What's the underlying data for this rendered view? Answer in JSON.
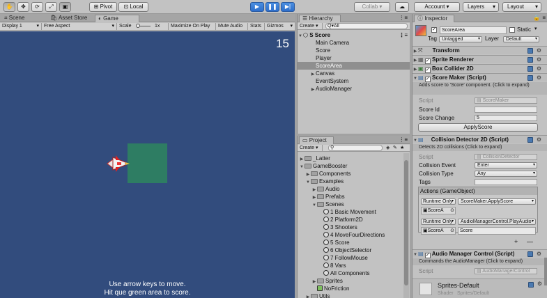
{
  "toolbar": {
    "pivot": "Pivot",
    "local": "Local",
    "play": "▶",
    "pause": "❚❚",
    "step": "▶|",
    "collab": "Collab ▾",
    "cloud": "☁",
    "account": "Account ▾",
    "layers": "Layers",
    "layout": "Layout"
  },
  "left_tabs": [
    "Scene",
    "Asset Store",
    "Game"
  ],
  "game_toolbar": {
    "display": "Display 1",
    "aspect": "Free Aspect",
    "scale_label": "Scale",
    "scale_value": "1x",
    "maximize": "Maximize On Play",
    "mute": "Mute Audio",
    "stats": "Stats",
    "gizmos": "Gizmos"
  },
  "game": {
    "score": "15",
    "instructions_line1": "Use arrow keys to move.",
    "instructions_line2": "Hit que green area to score.",
    "colors": {
      "background": "#324c7d",
      "score_area": "#2e7d63"
    }
  },
  "hierarchy": {
    "tab": "Hierarchy",
    "create": "Create ▾",
    "search_placeholder": "Q▾All",
    "scene_name": "S Score",
    "items": [
      {
        "label": "Main Camera",
        "indent": 1,
        "arrow": "",
        "selected": false
      },
      {
        "label": "Score",
        "indent": 1,
        "arrow": "",
        "selected": false
      },
      {
        "label": "Player",
        "indent": 1,
        "arrow": "",
        "selected": false
      },
      {
        "label": "ScoreArea",
        "indent": 1,
        "arrow": "",
        "selected": true
      },
      {
        "label": "Canvas",
        "indent": 1,
        "arrow": "▶",
        "selected": false
      },
      {
        "label": "EventSystem",
        "indent": 1,
        "arrow": "",
        "selected": false
      },
      {
        "label": "AudioManager",
        "indent": 1,
        "arrow": "▶",
        "selected": false
      }
    ]
  },
  "project": {
    "tab": "Project",
    "create": "Create ▾",
    "items": [
      {
        "label": "_Latter",
        "type": "folder",
        "indent": 0,
        "arrow": "▶"
      },
      {
        "label": "GameBooster",
        "type": "folder",
        "indent": 0,
        "arrow": "▼"
      },
      {
        "label": "Components",
        "type": "folder",
        "indent": 1,
        "arrow": "▶"
      },
      {
        "label": "Examples",
        "type": "folder",
        "indent": 1,
        "arrow": "▼"
      },
      {
        "label": "Audio",
        "type": "folder",
        "indent": 2,
        "arrow": "▶"
      },
      {
        "label": "Prefabs",
        "type": "folder",
        "indent": 2,
        "arrow": "▶"
      },
      {
        "label": "Scenes",
        "type": "folder",
        "indent": 2,
        "arrow": "▼"
      },
      {
        "label": "1 Basic Movement",
        "type": "scene",
        "indent": 3,
        "arrow": ""
      },
      {
        "label": "2 Platform2D",
        "type": "scene",
        "indent": 3,
        "arrow": ""
      },
      {
        "label": "3 Shooters",
        "type": "scene",
        "indent": 3,
        "arrow": ""
      },
      {
        "label": "4 MoveFourDirections",
        "type": "scene",
        "indent": 3,
        "arrow": ""
      },
      {
        "label": "5 Score",
        "type": "scene",
        "indent": 3,
        "arrow": ""
      },
      {
        "label": "6 ObjectSelector",
        "type": "scene",
        "indent": 3,
        "arrow": ""
      },
      {
        "label": "7 FollowMouse",
        "type": "scene",
        "indent": 3,
        "arrow": ""
      },
      {
        "label": "8 Vars",
        "type": "scene",
        "indent": 3,
        "arrow": ""
      },
      {
        "label": "All Components",
        "type": "scene",
        "indent": 3,
        "arrow": ""
      },
      {
        "label": "Sprites",
        "type": "folder",
        "indent": 2,
        "arrow": "▶"
      },
      {
        "label": "NoFriction",
        "type": "asset",
        "indent": 2,
        "arrow": ""
      },
      {
        "label": "Utils",
        "type": "folder",
        "indent": 1,
        "arrow": "▶"
      }
    ]
  },
  "inspector": {
    "tab": "Inspector",
    "object_name": "ScoreArea",
    "static": "Static",
    "tag_label": "Tag",
    "tag_value": "Untagged",
    "layer_label": "Layer",
    "layer_value": "Default",
    "components": {
      "transform": "Transform",
      "sprite_renderer": "Sprite Renderer",
      "box_collider": "Box Collider 2D",
      "score_maker": {
        "title": "Score Maker (Script)",
        "desc": "Adds score to 'Score' component. (Click to expand)",
        "script_label": "Script",
        "script_value": "ScoreMaker",
        "score_id_label": "Score Id",
        "score_id_value": "",
        "score_change_label": "Score Change",
        "score_change_value": "5",
        "button": "ApplyScore"
      },
      "collision_detector": {
        "title": "Collision Detector 2D (Script)",
        "desc": "Detects 2D collisions (Click to expand)",
        "script_label": "Script",
        "script_value": "CollisionDetector",
        "event_label": "Collision Event",
        "event_value": "Enter",
        "type_label": "Collision Type",
        "type_value": "Any",
        "tags_label": "Tags",
        "tags_value": "",
        "actions_label": "Actions (GameObject)",
        "actions": [
          {
            "runtime": "Runtime Only",
            "function": "ScoreMaker.ApplyScore",
            "object": "ScoreA",
            "arg": ""
          },
          {
            "runtime": "Runtime Only",
            "function": "AudioManagerControl.PlayAudio",
            "object": "ScoreA",
            "arg": "Score"
          }
        ],
        "plus": "+",
        "minus": "—"
      },
      "audio_manager": {
        "title": "Audio Manager Control (Script)",
        "desc": "Commands the AudioManager (Click to expand)",
        "script_label": "Script",
        "script_value": "AudioManagerControl"
      },
      "material": {
        "name": "Sprites-Default",
        "shader_label": "Shader",
        "shader_value": "Sprites/Default"
      }
    }
  }
}
